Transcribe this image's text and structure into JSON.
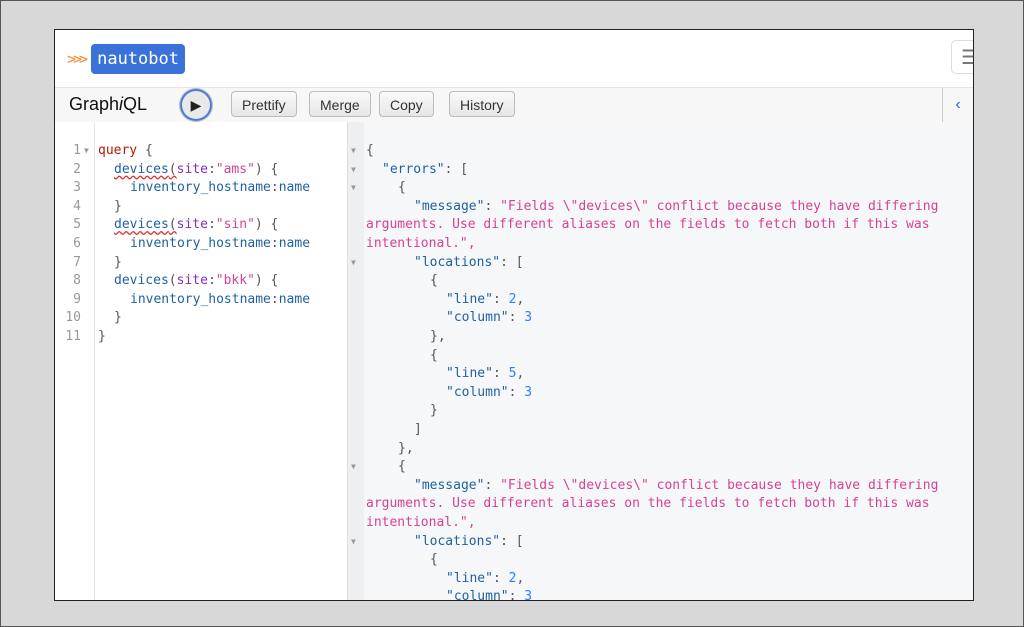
{
  "brand": {
    "arrows": ">>>",
    "name": "nautobot"
  },
  "toolbar": {
    "title_prefix": "Graph",
    "title_i": "i",
    "title_suffix": "QL",
    "run_icon": "play-icon",
    "buttons": [
      "Prettify",
      "Merge",
      "Copy",
      "History"
    ]
  },
  "editor": {
    "line_numbers": [
      "1",
      "2",
      "3",
      "4",
      "5",
      "6",
      "7",
      "8",
      "9",
      "10",
      "11"
    ],
    "lines": [
      {
        "keyword": "query",
        "rest": " {"
      },
      {
        "field": "devices",
        "arg": "site",
        "val": "\"ams\"",
        "close": ") {"
      },
      {
        "prop": "inventory_hostname",
        "alias": "name"
      },
      {
        "punc": "}"
      },
      {
        "field": "devices",
        "arg": "site",
        "val": "\"sin\"",
        "close": ") {"
      },
      {
        "prop": "inventory_hostname",
        "alias": "name"
      },
      {
        "punc": "}"
      },
      {
        "field": "devices",
        "arg": "site",
        "val": "\"bkk\"",
        "close": ") {"
      },
      {
        "prop": "inventory_hostname",
        "alias": "name"
      },
      {
        "punc": "}"
      },
      {
        "punc": "}"
      }
    ]
  },
  "result": {
    "errors_key": "\"errors\"",
    "message_key": "\"message\"",
    "message_line1": "\"Fields \\\"devices\\\" conflict because they have differing",
    "message_line2": "arguments. Use different aliases on the fields to fetch both if this was",
    "message_line3": "intentional.\",",
    "locations_key": "\"locations\"",
    "line_key": "\"line\"",
    "column_key": "\"column\"",
    "err1": {
      "loc1": {
        "line": "2",
        "column": "3"
      },
      "loc2": {
        "line": "5",
        "column": "3"
      }
    },
    "err2": {
      "loc1": {
        "line": "2",
        "column": "3"
      }
    }
  }
}
